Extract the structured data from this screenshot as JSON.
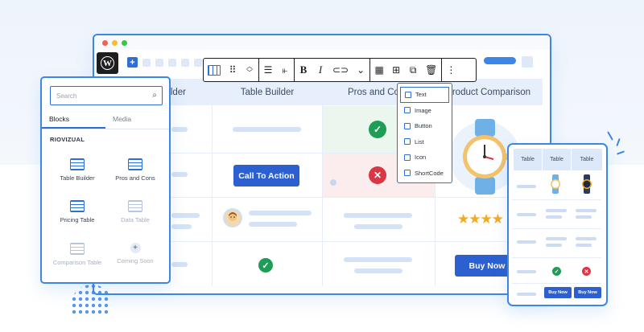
{
  "toolbar": {
    "logo_letter": "W",
    "add_label": "+"
  },
  "block_toolbar": {
    "bold": "B",
    "italic": "I",
    "more": "⋮"
  },
  "table": {
    "headers": [
      "Table Builder",
      "Table Builder",
      "Pros and Cons",
      "Product Comparison"
    ],
    "cta_label": "Call To Action",
    "buy_label": "Buy Now",
    "stars": "★★★★"
  },
  "insert_menu": {
    "items": [
      "Text",
      "Image",
      "Button",
      "List",
      "Icon",
      "ShortCode"
    ]
  },
  "inserter": {
    "search_placeholder": "Search",
    "tabs": [
      "Blocks",
      "Media"
    ],
    "section": "RIOVIZUAL",
    "blocks": [
      "Table Builder",
      "Pros and Cons",
      "Pricing Table",
      "Data Table",
      "Comparison Table",
      "Coming Soon"
    ]
  },
  "mobile": {
    "headers": [
      "Table",
      "Table",
      "Table"
    ],
    "buy_label": "Buy Now"
  },
  "colors": {
    "accent": "#2c6fd8",
    "border": "#3b86e6",
    "success": "#1f9d57",
    "danger": "#d93646",
    "star": "#f3a826"
  }
}
